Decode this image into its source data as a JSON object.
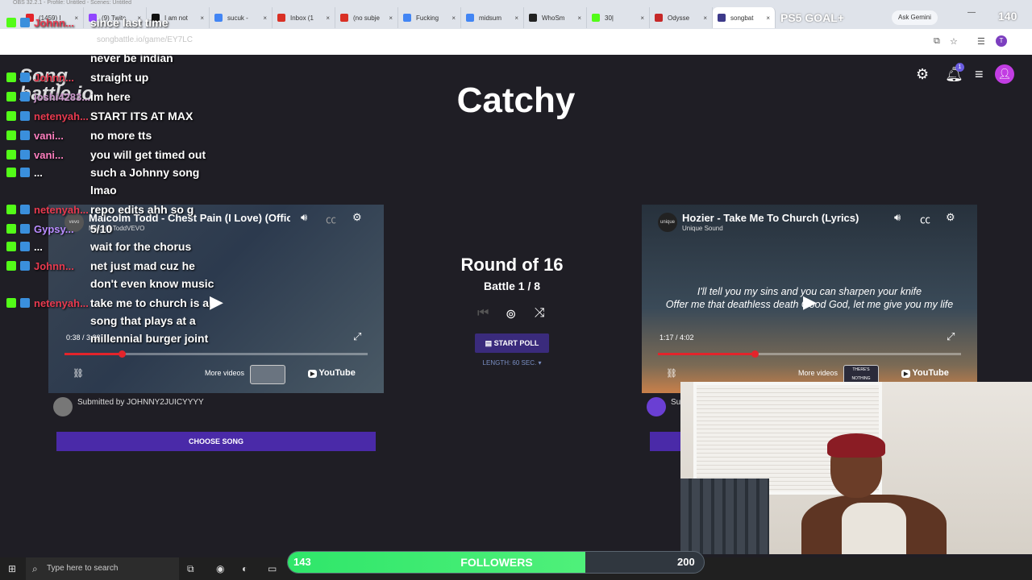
{
  "obs_title": "OBS 32.2.1 - Profile: Untitled - Scenes: Untitled",
  "tabs": [
    {
      "label": "(1459) I",
      "color": "#e3242b"
    },
    {
      "label": "(9) Twitc",
      "color": "#9146ff"
    },
    {
      "label": "I am not",
      "color": "#111111"
    },
    {
      "label": "sucuk -",
      "color": "#4285f4"
    },
    {
      "label": "Inbox (1",
      "color": "#d93025"
    },
    {
      "label": "(no subje",
      "color": "#d93025"
    },
    {
      "label": "Fucking",
      "color": "#4285f4"
    },
    {
      "label": "midsum",
      "color": "#4285f4"
    },
    {
      "label": "WhoSm",
      "color": "#222222"
    },
    {
      "label": "30|",
      "color": "#53fc18"
    },
    {
      "label": "Odysse",
      "color": "#c62828"
    },
    {
      "label": "songbat",
      "color": "#3d3a8a"
    }
  ],
  "overlay": {
    "ps5_goal": "PS5 GOAL+",
    "count": "140"
  },
  "browser": {
    "ask_gemini": "Ask Gemini",
    "url": "songbattle.io/game/EY7LC"
  },
  "site": {
    "logo_line1": "Song",
    "logo_line2": "battle.io",
    "title": "Catchy",
    "notification_count": "1"
  },
  "left_video": {
    "title": "Malcolm Todd - Chest Pain (I Love) (Offic",
    "channel": "MalcolmToddVEVO",
    "time": "0:38 / 3:33",
    "progress": 0.19,
    "more_videos": "More videos",
    "youtube": "YouTube",
    "submitted_by": "Submitted by JOHNNY2JUICYYYY",
    "choose_song": "CHOOSE SONG"
  },
  "right_video": {
    "title": "Hozier - Take Me To Church (Lyrics)",
    "channel": "Unique Sound",
    "time": "1:17 / 4:02",
    "progress": 0.32,
    "more_videos": "More videos",
    "youtube": "YouTube",
    "thumb_text": "THERE'S NOTHING HOLDING ME BACK",
    "lyric_line1": "I'll tell you my sins and you can sharpen your knife",
    "lyric_line2": "Offer me that deathless death Good God, let me give you my life",
    "submitted_prefix": "Su"
  },
  "center": {
    "round": "Round of 16",
    "battle": "Battle 1 / 8",
    "start_poll": "START POLL",
    "length": "LENGTH: 60 SEC. ▾"
  },
  "chat": [
    {
      "user": "Johnn...",
      "color": "#e83a4f",
      "msg": "since last time"
    },
    {
      "user": "",
      "color": "#ffffff",
      "msg": "never be indian"
    },
    {
      "user": "Johnn...",
      "color": "#e83a4f",
      "msg": "straight up"
    },
    {
      "user": "joshi4283...",
      "color": "#c9c",
      "msg": "im here"
    },
    {
      "user": "netenyah...",
      "color": "#e83a4f",
      "msg": "START ITS AT MAX"
    },
    {
      "user": "vani...",
      "color": "#ff7fbf",
      "msg": "no more tts"
    },
    {
      "user": "vani...",
      "color": "#ff7fbf",
      "msg": "you will get timed out"
    },
    {
      "user": "...",
      "color": "#ffffff",
      "msg": "such a Johnny song"
    },
    {
      "user": "",
      "color": "#ffffff",
      "msg": "lmao"
    },
    {
      "user": "netenyah...",
      "color": "#e83a4f",
      "msg": "repo edits ahh so g"
    },
    {
      "user": "Gypsy...",
      "color": "#b98bff",
      "msg": "5/10"
    },
    {
      "user": "...",
      "color": "#ffffff",
      "msg": "wait for the chorus"
    },
    {
      "user": "Johnn...",
      "color": "#e83a4f",
      "msg": "net just mad cuz he"
    },
    {
      "user": "",
      "color": "#ffffff",
      "msg": "don't even know music"
    },
    {
      "user": "netenyah...",
      "color": "#e83a4f",
      "msg": "take me to church is a"
    },
    {
      "user": "",
      "color": "#ffffff",
      "msg": "song that plays at a"
    },
    {
      "user": "",
      "color": "#ffffff",
      "msg": "millennial burger joint"
    }
  ],
  "goal": {
    "current": "143",
    "label": "FOLLOWERS",
    "target": "200",
    "progress": 0.715
  },
  "taskbar": {
    "search_placeholder": "Type here to search"
  }
}
